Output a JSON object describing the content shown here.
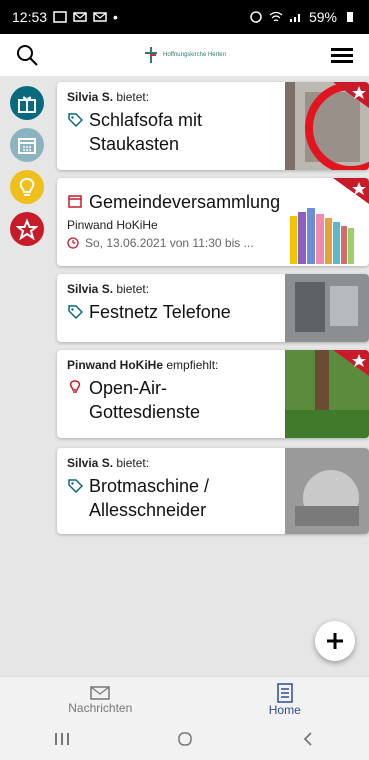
{
  "statusbar": {
    "time": "12:53",
    "battery": "59%"
  },
  "header": {
    "logo_text": "Hoffnungskirche Herten"
  },
  "cards": [
    {
      "prefix_name": "Silvia S.",
      "prefix_verb": " bietet:",
      "title": "Schlafsofa mit Staukasten"
    },
    {
      "title": "Gemeindeversammlung",
      "subtitle": "Pinwand HoKiHe",
      "date": "So, 13.06.2021 von 11:30 bis ..."
    },
    {
      "prefix_name": "Silvia S.",
      "prefix_verb": " bietet:",
      "title": "Festnetz Telefone"
    },
    {
      "prefix_name": "Pinwand HoKiHe",
      "prefix_verb": " empfiehlt:",
      "title": "Open-Air-Gottesdienste"
    },
    {
      "prefix_name": "Silvia S.",
      "prefix_verb": " bietet:",
      "title": "Brotmaschine / Allesschneider"
    }
  ],
  "bottom_nav": {
    "messages": "Nachrichten",
    "home": "Home"
  },
  "colors": {
    "teal": "#0a6a7d",
    "red": "#c81b2a",
    "yellow": "#f1bf1b",
    "navy": "#2e4f91"
  }
}
